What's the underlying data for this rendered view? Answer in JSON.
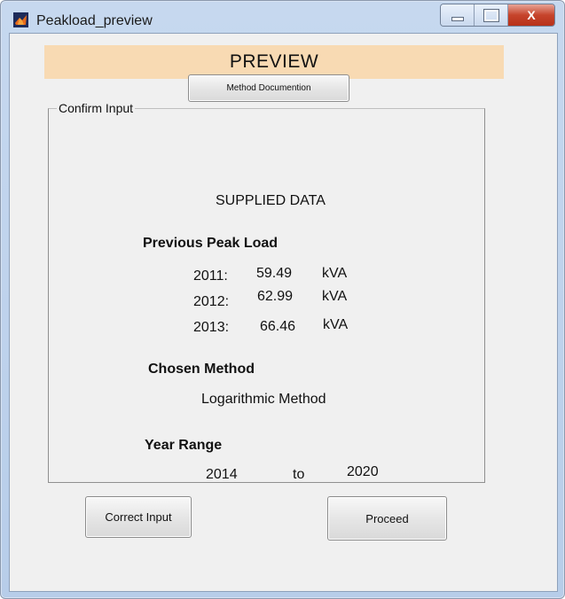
{
  "window": {
    "title": "Peakload_preview",
    "controls": {
      "minimize": "",
      "maximize": "",
      "close": "X"
    }
  },
  "banner": {
    "text": "PREVIEW"
  },
  "buttons": {
    "method_doc": "Method Documention",
    "correct_input": "Correct Input",
    "proceed": "Proceed"
  },
  "group": {
    "legend": "Confirm Input",
    "supplied_heading": "SUPPLIED DATA",
    "previous_peak_heading": "Previous Peak Load",
    "peak_loads": [
      {
        "year": "2011:",
        "value": "59.49",
        "unit": "kVA"
      },
      {
        "year": "2012:",
        "value": "62.99",
        "unit": "kVA"
      },
      {
        "year": "2013:",
        "value": "66.46",
        "unit": "kVA"
      }
    ],
    "method_heading": "Chosen Method",
    "method_value": "Logarithmic Method",
    "range_heading": "Year Range",
    "range_start": "2014",
    "range_to": "to",
    "range_end": "2020"
  },
  "colors": {
    "banner": "#f8dab3",
    "panel": "#f0f0f0",
    "title_bar": "#c6d8ef",
    "close_button": "#c6442c"
  }
}
